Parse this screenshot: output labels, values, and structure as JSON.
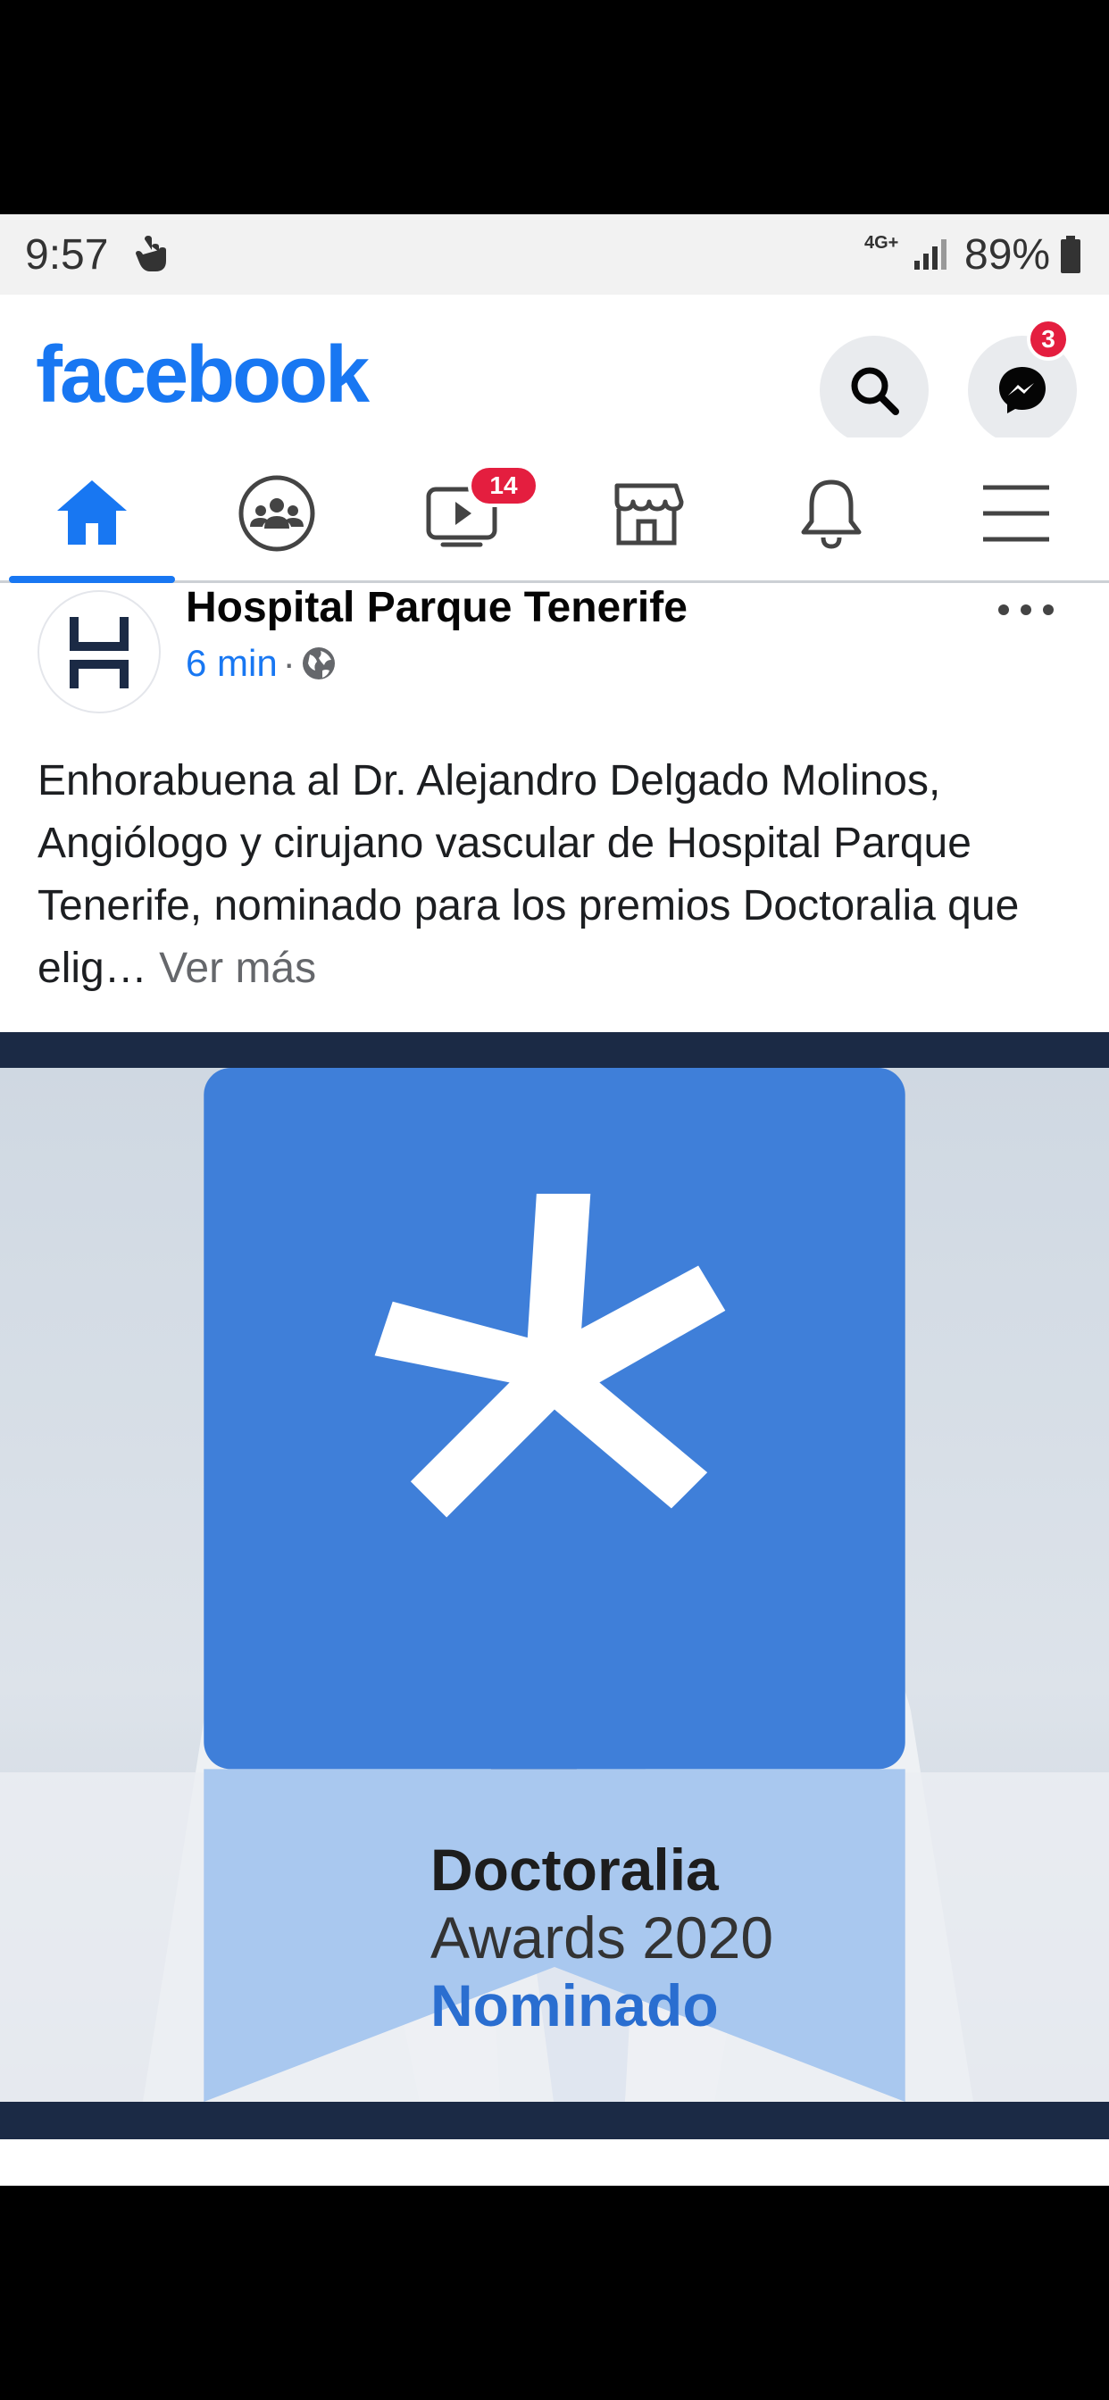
{
  "status_bar": {
    "time": "9:57",
    "network": "4G+",
    "battery": "89%"
  },
  "app": {
    "logo": "facebook",
    "messenger_badge": "3",
    "brand_color": "#1877f2"
  },
  "nav": {
    "tabs": [
      {
        "name": "home-icon",
        "active": true
      },
      {
        "name": "groups-icon"
      },
      {
        "name": "watch-icon",
        "badge": "14"
      },
      {
        "name": "marketplace-icon"
      },
      {
        "name": "bell-icon"
      },
      {
        "name": "menu-icon"
      }
    ]
  },
  "post": {
    "page_name": "Hospital Parque Tenerife",
    "time": "6 min",
    "text": "Enhorabuena al Dr. Alejandro Delgado Molinos, Angiólogo y cirujano vascular de Hospital Parque Tenerife, nominado para los premios Doctoralia que elig… ",
    "see_more": "Ver más",
    "image": {
      "award_title": "Doctoralia",
      "award_year": "Awards 2020",
      "award_status": "Nominado"
    }
  }
}
